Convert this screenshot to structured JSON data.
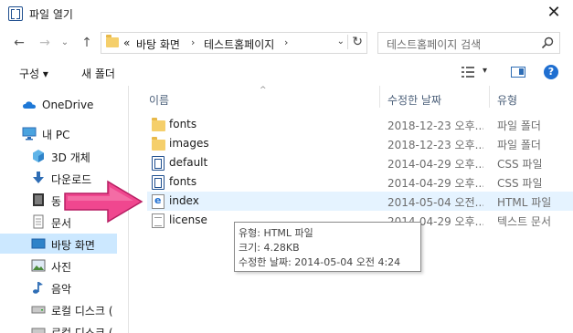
{
  "window": {
    "title": "파일 열기",
    "close_glyph": "✕"
  },
  "nav": {
    "back_glyph": "←",
    "forward_glyph": "→",
    "recent_glyph": "⌄",
    "up_glyph": "↑",
    "overflow": "«",
    "breadcrumb": [
      "바탕 화면",
      "테스트홈페이지"
    ],
    "sep_glyph": "›",
    "dropdown_glyph": "⌄",
    "refresh_glyph": "↻"
  },
  "search": {
    "placeholder": "테스트홈페이지 검색",
    "icon": "search-icon"
  },
  "toolbar": {
    "organize_label": "구성 ▾",
    "new_folder_label": "새 폴더",
    "view_dd_glyph": "▾",
    "help_glyph": "?"
  },
  "sidebar": {
    "items": [
      {
        "label": "OneDrive",
        "icon": "cloud-icon"
      },
      {
        "label": "내 PC",
        "icon": "computer-icon"
      },
      {
        "label": "3D 개체",
        "icon": "cube-icon"
      },
      {
        "label": "다운로드",
        "icon": "download-icon"
      },
      {
        "label": "동",
        "icon": "video-icon"
      },
      {
        "label": "문서",
        "icon": "document-icon"
      },
      {
        "label": "바탕 화면",
        "icon": "desktop-icon",
        "selected": true
      },
      {
        "label": "사진",
        "icon": "picture-icon"
      },
      {
        "label": "음악",
        "icon": "music-icon"
      },
      {
        "label": "로컬 디스크 (",
        "icon": "disk-icon"
      },
      {
        "label": "로컬 디스크 (",
        "icon": "disk-icon"
      }
    ]
  },
  "columns": {
    "name": "이름",
    "date": "수정한 날짜",
    "type": "유형",
    "sort_glyph": "^"
  },
  "files": [
    {
      "name": "fonts",
      "date": "2018-12-23 오후...",
      "type": "파일 폴더",
      "icon": "folder-icon"
    },
    {
      "name": "images",
      "date": "2018-12-23 오후...",
      "type": "파일 폴더",
      "icon": "folder-icon"
    },
    {
      "name": "default",
      "date": "2014-04-29 오후...",
      "type": "CSS 파일",
      "icon": "css-file-icon"
    },
    {
      "name": "fonts",
      "date": "2014-04-29 오후...",
      "type": "CSS 파일",
      "icon": "css-file-icon"
    },
    {
      "name": "index",
      "date": "2014-05-04 오전...",
      "type": "HTML 파일",
      "icon": "html-file-icon",
      "hover": true
    },
    {
      "name": "license",
      "date": "2014-04-29 오후...",
      "type": "텍스트 문서",
      "icon": "text-file-icon"
    }
  ],
  "tooltip": {
    "type_line": "유형: HTML 파일",
    "size_line": "크기: 4.28KB",
    "date_line": "수정한 날짜: 2014-05-04 오전 4:24"
  },
  "annotation": {
    "icon": "pink-arrow-icon",
    "color": "#f0478f"
  }
}
